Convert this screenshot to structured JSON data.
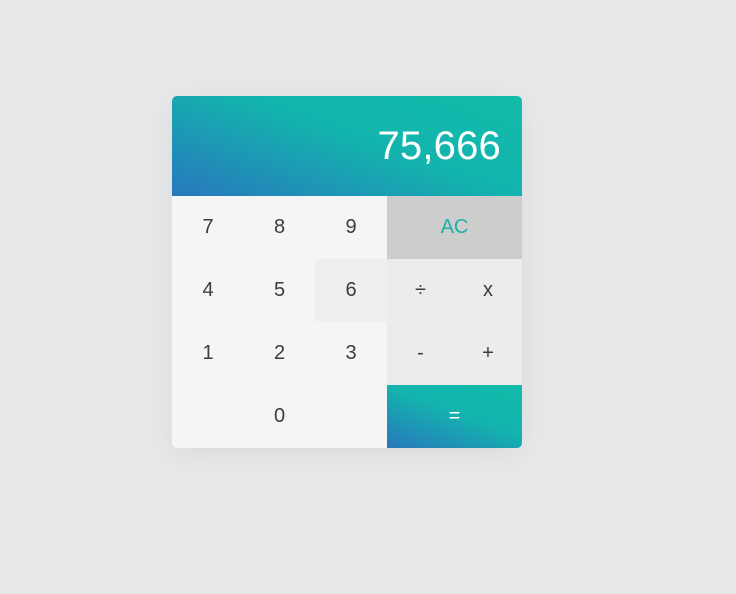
{
  "display": {
    "value": "75,666"
  },
  "keys": {
    "seven": "7",
    "eight": "8",
    "nine": "9",
    "four": "4",
    "five": "5",
    "six": "6",
    "one": "1",
    "two": "2",
    "three": "3",
    "zero": "0",
    "clear": "AC",
    "divide": "÷",
    "multiply": "x",
    "subtract": "-",
    "add": "+",
    "equals": "="
  },
  "colors": {
    "accent_teal": "#12bcaa",
    "accent_blue": "#2878bd",
    "background": "#e7e8ea"
  }
}
